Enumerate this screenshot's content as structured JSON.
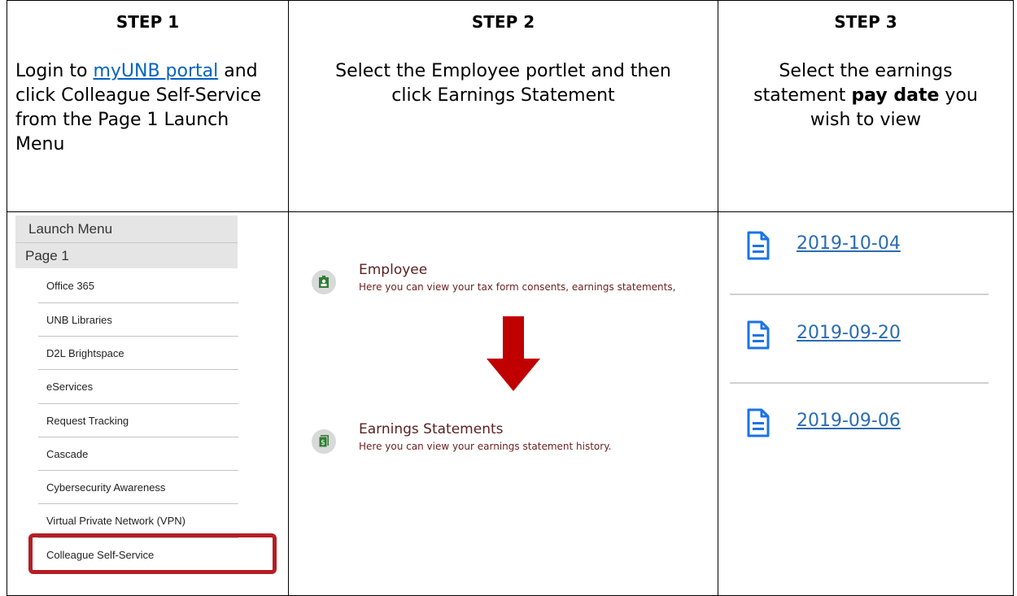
{
  "steps": {
    "step1": {
      "heading": "STEP 1",
      "prefix": "Login to ",
      "link_text": "myUNB portal",
      "suffix": " and click Colleague Self-Service from the Page 1 Launch Menu"
    },
    "step2": {
      "heading": "STEP 2",
      "text": "Select the Employee portlet and then click Earnings Statement"
    },
    "step3": {
      "heading": "STEP 3",
      "prefix": "Select the earnings statement ",
      "bold": "pay date",
      "suffix": " you wish to view"
    }
  },
  "launch_menu": {
    "title": "Launch Menu",
    "page": "Page 1",
    "items": [
      "Office 365",
      "UNB Libraries",
      "D2L Brightspace",
      "eServices",
      "Request Tracking",
      "Cascade",
      "Cybersecurity Awareness",
      "Virtual Private Network (VPN)",
      "Colleague Self-Service"
    ]
  },
  "portlets": {
    "employee": {
      "title": "Employee",
      "desc": "Here you can view your tax form consents, earnings statements,"
    },
    "earnings": {
      "title": "Earnings Statements",
      "desc": "Here you can view your earnings statement history."
    }
  },
  "statements": [
    "2019-10-04",
    "2019-09-20",
    "2019-09-06"
  ],
  "colors": {
    "link": "#0563c1",
    "highlight": "#b41e25",
    "arrow": "#c00000",
    "portlet_text": "#5b1e1e",
    "statement_link": "#2b6cb0",
    "icon_green": "#2e7d32"
  },
  "icons": [
    "employee-badge-icon",
    "dollar-document-icon",
    "down-arrow-icon",
    "document-icon"
  ]
}
